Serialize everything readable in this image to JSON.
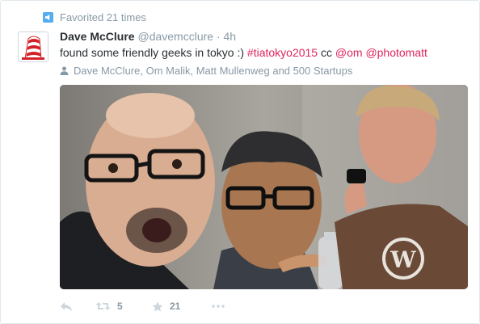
{
  "context": {
    "icon": "favorite-context-icon",
    "text": "Favorited 21 times"
  },
  "tweet": {
    "fullname": "Dave McClure",
    "username": "@davemcclure",
    "separator": "·",
    "time": "4h",
    "text_plain": "found some friendly geeks in tokyo :) ",
    "hashtag": "#tiatokyo2015",
    "text_cc": " cc ",
    "mention1": "@om",
    "mention2": "@photomatt",
    "media_tags": "Dave McClure, Om Malik, Matt Mullenweg and 500 Startups"
  },
  "actions": {
    "reply_icon": "reply-icon",
    "retweet_icon": "retweet-icon",
    "retweet_count": "5",
    "favorite_icon": "star-icon",
    "favorite_count": "21",
    "more_icon": "more-dots-icon"
  },
  "colors": {
    "accent": "#55acee",
    "link": "#e0245e",
    "muted": "#8899a6",
    "text": "#292f33",
    "border": "#e1e8ed"
  }
}
